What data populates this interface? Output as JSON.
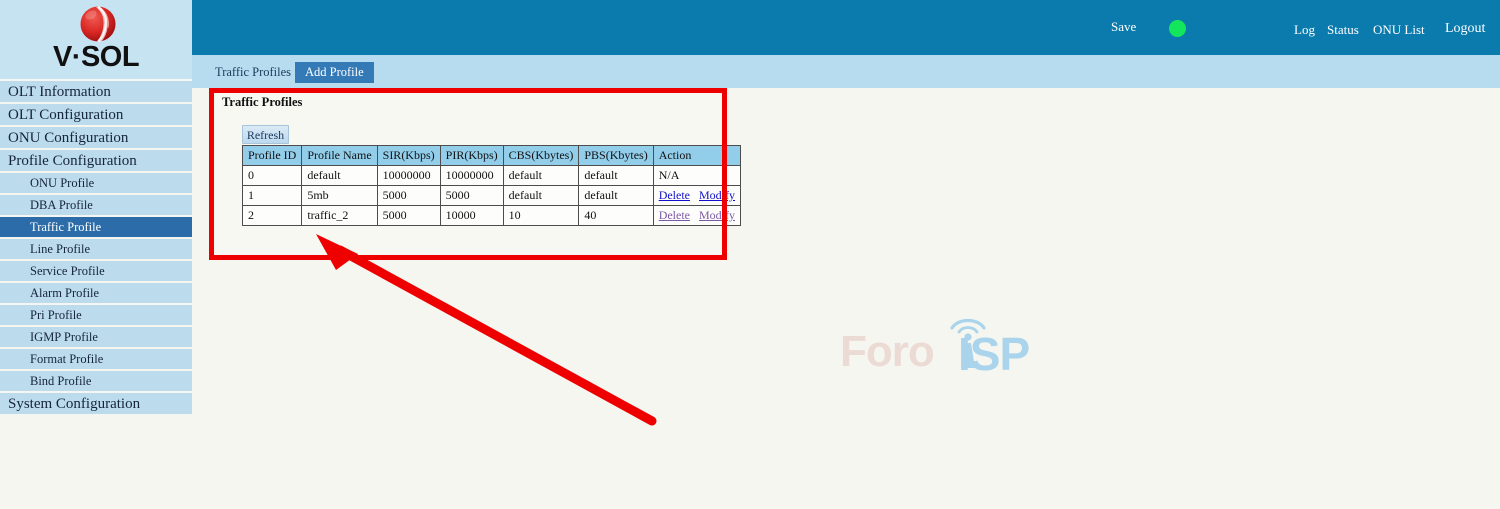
{
  "header": {
    "save_label": "Save",
    "status_dot": "green-status-indicator",
    "status_color": "#13e65b",
    "links": [
      {
        "label": "Log"
      },
      {
        "label": "Status"
      },
      {
        "label": "ONU List"
      },
      {
        "label": "Logout"
      }
    ]
  },
  "brand": {
    "name": "V·SOL",
    "mark": "vsol-sphere-logo",
    "mark_color": "#d8232a"
  },
  "sidebar": {
    "items": [
      {
        "label": "OLT Information",
        "level": "top",
        "selected": false
      },
      {
        "label": "OLT Configuration",
        "level": "top",
        "selected": false
      },
      {
        "label": "ONU Configuration",
        "level": "top",
        "selected": false
      },
      {
        "label": "Profile Configuration",
        "level": "top",
        "selected": false
      },
      {
        "label": "ONU Profile",
        "level": "sub",
        "selected": false
      },
      {
        "label": "DBA Profile",
        "level": "sub",
        "selected": false
      },
      {
        "label": "Traffic Profile",
        "level": "sub",
        "selected": true
      },
      {
        "label": "Line Profile",
        "level": "sub",
        "selected": false
      },
      {
        "label": "Service Profile",
        "level": "sub",
        "selected": false
      },
      {
        "label": "Alarm Profile",
        "level": "sub",
        "selected": false
      },
      {
        "label": "Pri Profile",
        "level": "sub",
        "selected": false
      },
      {
        "label": "IGMP Profile",
        "level": "sub",
        "selected": false
      },
      {
        "label": "Format Profile",
        "level": "sub",
        "selected": false
      },
      {
        "label": "Bind Profile",
        "level": "sub",
        "selected": false
      },
      {
        "label": "System Configuration",
        "level": "top",
        "selected": false
      }
    ],
    "selected_color": "#2c6ca8"
  },
  "tabs": [
    {
      "label": "Traffic Profiles",
      "active": false
    },
    {
      "label": "Add Profile",
      "active": true
    }
  ],
  "panel": {
    "title": "Traffic Profiles",
    "refresh_label": "Refresh"
  },
  "table": {
    "columns": [
      "Profile ID",
      "Profile Name",
      "SIR(Kbps)",
      "PIR(Kbps)",
      "CBS(Kbytes)",
      "PBS(Kbytes)",
      "Action"
    ],
    "rows": [
      {
        "profile_id": "0",
        "profile_name": "default",
        "sir": "10000000",
        "pir": "10000000",
        "cbs": "default",
        "pbs": "default",
        "action_text": "N/A",
        "has_links": false,
        "visited": false
      },
      {
        "profile_id": "1",
        "profile_name": "5mb",
        "sir": "5000",
        "pir": "5000",
        "cbs": "default",
        "pbs": "default",
        "action_text": "",
        "has_links": true,
        "visited": false,
        "delete_label": "Delete",
        "modify_label": "Modify"
      },
      {
        "profile_id": "2",
        "profile_name": "traffic_2",
        "sir": "5000",
        "pir": "10000",
        "cbs": "10",
        "pbs": "40",
        "action_text": "",
        "has_links": true,
        "visited": true,
        "delete_label": "Delete",
        "modify_label": "Modify"
      }
    ]
  },
  "annotations": {
    "highlight_color": "#ee0000",
    "rect_name": "red-highlight-rectangle",
    "arrow_name": "red-pointer-arrow"
  },
  "watermark": {
    "text": "Foro",
    "accent_text": "ISP",
    "accent_color": "#a9d4ec"
  }
}
